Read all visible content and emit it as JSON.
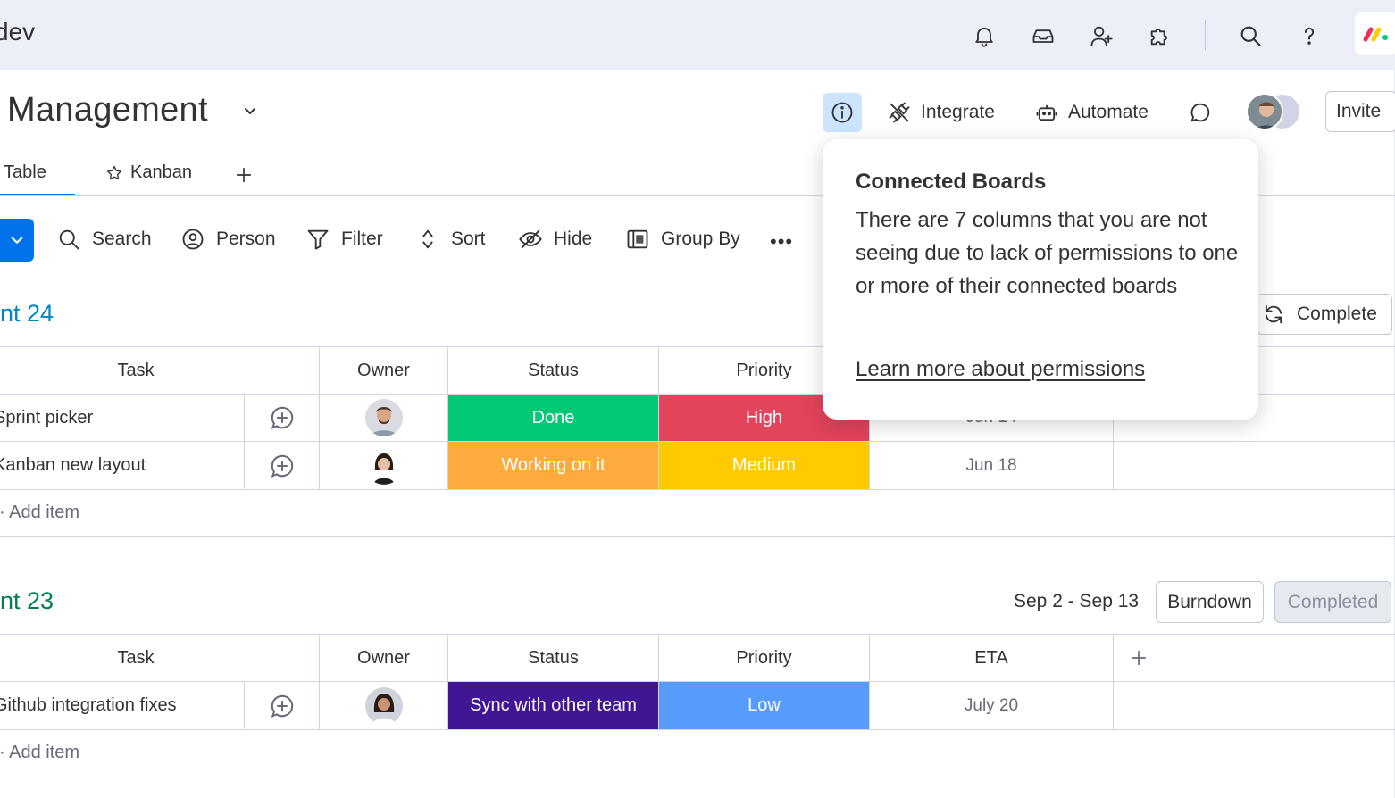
{
  "topbar": {
    "workspace": "dev",
    "icons": [
      "bell-icon",
      "inbox-icon",
      "invite-user-icon",
      "apps-puzzle-icon",
      "search-icon",
      "help-icon"
    ],
    "logo": "monday-logo"
  },
  "board": {
    "title": "Management",
    "actions": {
      "integrate": "Integrate",
      "automate": "Automate"
    },
    "invite": "Invite"
  },
  "tabs": [
    {
      "label": "Table"
    },
    {
      "label": "Kanban"
    }
  ],
  "toolbar": {
    "search": "Search",
    "person": "Person",
    "filter": "Filter",
    "sort": "Sort",
    "hide": "Hide",
    "group_by": "Group By",
    "more": "•••"
  },
  "columns": {
    "task": "Task",
    "owner": "Owner",
    "status": "Status",
    "priority": "Priority",
    "eta": "ETA"
  },
  "groups": [
    {
      "title": "nt 24",
      "button": "Complete",
      "rows": [
        {
          "task": "Sprint picker",
          "status": "Done",
          "status_color": "#00c875",
          "priority": "High",
          "priority_color": "#e2445c",
          "eta": "Jun 14"
        },
        {
          "task": "Kanban new layout",
          "status": "Working on it",
          "status_color": "#fdab3d",
          "priority": "Medium",
          "priority_color": "#ffcb00",
          "eta": "Jun 18"
        }
      ],
      "add_item": "Add item"
    },
    {
      "title": "nt 23",
      "date_range": "Sep 2 - Sep 13",
      "burndown": "Burndown",
      "completed": "Completed",
      "rows": [
        {
          "task": "Github integration fixes",
          "status": "Sync with other team",
          "status_color": "#401694",
          "priority": "Low",
          "priority_color": "#579bfc",
          "eta": "July 20"
        }
      ],
      "add_item": "Add item"
    }
  ],
  "popover": {
    "title": "Connected Boards",
    "body": "There are 7 columns that you are not seeing due to lack of permissions to one or more of their connected boards",
    "link": "Learn more about permissions"
  },
  "colors": {
    "accent": "#0073ea",
    "info_bg": "#cce5ff",
    "group1": "#0086c0",
    "group2": "#037f4c"
  }
}
